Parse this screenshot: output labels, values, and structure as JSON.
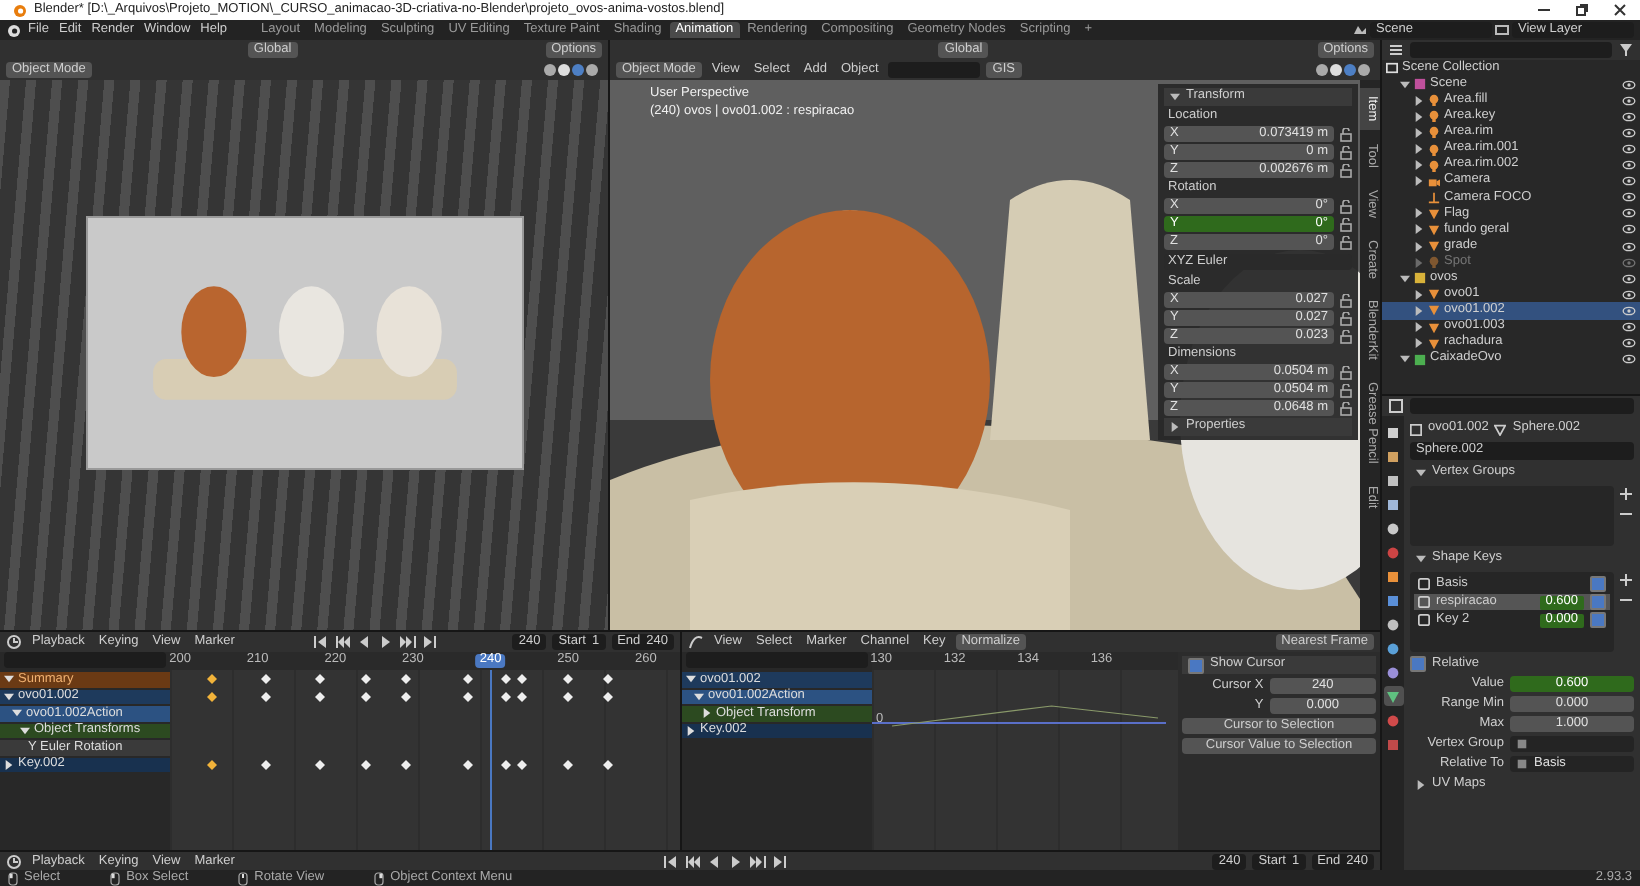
{
  "title_bar": {
    "title": "Blender* [D:\\_Arquivos\\Projeto_MOTION\\_CURSO_animacao-3D-criativa-no-Blender\\projeto_ovos-anima-vostos.blend]"
  },
  "menu_bar": {
    "menus": [
      "File",
      "Edit",
      "Render",
      "Window",
      "Help"
    ],
    "workspaces": [
      {
        "label": "Layout",
        "selected": false
      },
      {
        "label": "Modeling",
        "selected": false
      },
      {
        "label": "Sculpting",
        "selected": false
      },
      {
        "label": "UV Editing",
        "selected": false
      },
      {
        "label": "Texture Paint",
        "selected": false
      },
      {
        "label": "Shading",
        "selected": false
      },
      {
        "label": "Animation",
        "selected": true
      },
      {
        "label": "Rendering",
        "selected": false
      },
      {
        "label": "Compositing",
        "selected": false
      },
      {
        "label": "Geometry Nodes",
        "selected": false
      },
      {
        "label": "Scripting",
        "selected": false
      }
    ],
    "add_workspace": "+",
    "scene": "Scene",
    "view_layer": "View Layer"
  },
  "camera_view": {
    "orientation": "Global",
    "options": "Options",
    "mode": "Object Mode"
  },
  "viewport": {
    "orientation": "Global",
    "options": "Options",
    "mode": "Object Mode",
    "menus": [
      "View",
      "Select",
      "Add",
      "Object"
    ],
    "gis": "GIS",
    "view_name": "User Perspective",
    "view_info": "(240) ovos | ovo01.002 : respiracao"
  },
  "n_panel": {
    "tabs": [
      {
        "label": "Item",
        "selected": true
      },
      {
        "label": "Tool",
        "selected": false
      },
      {
        "label": "View",
        "selected": false
      },
      {
        "label": "Create",
        "selected": false
      },
      {
        "label": "BlenderKit",
        "selected": false
      },
      {
        "label": "Grease Pencil",
        "selected": false
      },
      {
        "label": "Edit",
        "selected": false
      }
    ],
    "transform": {
      "title": "Transform",
      "expanded": true,
      "groups": [
        {
          "label": "Location",
          "fields": [
            {
              "axis": "X",
              "value": "0.073419 m",
              "keyed": false
            },
            {
              "axis": "Y",
              "value": "0 m",
              "keyed": false
            },
            {
              "axis": "Z",
              "value": "0.002676 m",
              "keyed": false
            }
          ]
        },
        {
          "label": "Rotation",
          "fields": [
            {
              "axis": "X",
              "value": "0°",
              "keyed": false
            },
            {
              "axis": "Y",
              "value": "0°",
              "keyed": true
            },
            {
              "axis": "Z",
              "value": "0°",
              "keyed": false
            }
          ],
          "mode": "XYZ Euler"
        },
        {
          "label": "Scale",
          "fields": [
            {
              "axis": "X",
              "value": "0.027",
              "keyed": false
            },
            {
              "axis": "Y",
              "value": "0.027",
              "keyed": false
            },
            {
              "axis": "Z",
              "value": "0.023",
              "keyed": false
            }
          ]
        },
        {
          "label": "Dimensions",
          "fields": [
            {
              "axis": "X",
              "value": "0.0504 m",
              "keyed": false
            },
            {
              "axis": "Y",
              "value": "0.0504 m",
              "keyed": false
            },
            {
              "axis": "Z",
              "value": "0.0648 m",
              "keyed": false
            }
          ]
        }
      ]
    },
    "properties": {
      "title": "Properties",
      "expanded": false
    }
  },
  "outliner": {
    "root": "Scene Collection",
    "items": [
      {
        "name": "Scene",
        "kind": "collection",
        "color": "#c0509c",
        "expanded": true,
        "selected": false,
        "disabled": false,
        "children": [
          {
            "name": "Area.fill",
            "kind": "light",
            "expanded": false,
            "selected": false,
            "disabled": false
          },
          {
            "name": "Area.key",
            "kind": "light",
            "expanded": false,
            "selected": false,
            "disabled": false
          },
          {
            "name": "Area.rim",
            "kind": "light",
            "expanded": false,
            "selected": false,
            "disabled": false
          },
          {
            "name": "Area.rim.001",
            "kind": "light",
            "expanded": false,
            "selected": false,
            "disabled": false
          },
          {
            "name": "Area.rim.002",
            "kind": "light",
            "expanded": false,
            "selected": false,
            "disabled": false
          },
          {
            "name": "Camera",
            "kind": "camera",
            "expanded": false,
            "selected": false,
            "disabled": false
          },
          {
            "name": "Camera FOCO",
            "kind": "empty",
            "selected": false,
            "disabled": false
          },
          {
            "name": "Flag",
            "kind": "mesh",
            "expanded": false,
            "selected": false,
            "disabled": false
          },
          {
            "name": "fundo geral",
            "kind": "mesh",
            "expanded": false,
            "selected": false,
            "disabled": false
          },
          {
            "name": "grade",
            "kind": "mesh",
            "expanded": false,
            "selected": false,
            "disabled": false
          },
          {
            "name": "Spot",
            "kind": "light",
            "expanded": false,
            "selected": false,
            "disabled": true
          }
        ]
      },
      {
        "name": "ovos",
        "kind": "collection",
        "color": "#d8b23a",
        "expanded": true,
        "selected": false,
        "disabled": false,
        "children": [
          {
            "name": "ovo01",
            "kind": "mesh",
            "expanded": false,
            "selected": false,
            "disabled": false
          },
          {
            "name": "ovo01.002",
            "kind": "mesh",
            "expanded": false,
            "selected": true,
            "disabled": false
          },
          {
            "name": "ovo01.003",
            "kind": "mesh",
            "expanded": false,
            "selected": false,
            "disabled": false
          },
          {
            "name": "rachadura",
            "kind": "mesh",
            "expanded": false,
            "selected": false,
            "disabled": false
          }
        ]
      },
      {
        "name": "CaixadeOvo",
        "kind": "collection",
        "color": "#4caf50",
        "expanded": true,
        "selected": false,
        "disabled": false
      }
    ]
  },
  "properties": {
    "tabs": [
      {
        "kind": "square",
        "selected": false
      },
      {
        "kind": "square",
        "selected": false
      },
      {
        "kind": "square",
        "selected": false
      },
      {
        "kind": "square",
        "selected": false
      },
      {
        "kind": "circle",
        "selected": false
      },
      {
        "kind": "circle",
        "selected": false
      },
      {
        "kind": "square",
        "selected": false
      },
      {
        "kind": "square",
        "selected": false
      },
      {
        "kind": "circle",
        "selected": false
      },
      {
        "kind": "circle",
        "selected": false
      },
      {
        "kind": "circle",
        "selected": false
      },
      {
        "kind": "triangle",
        "selected": true
      },
      {
        "kind": "circle",
        "selected": false
      },
      {
        "kind": "square",
        "selected": false
      }
    ],
    "breadcrumb": [
      "ovo01.002",
      "Sphere.002"
    ],
    "mesh": "Sphere.002",
    "vertex_groups": {
      "title": "Vertex Groups",
      "expanded": true
    },
    "shape_keys": {
      "title": "Shape Keys",
      "expanded": true,
      "keys": [
        {
          "name": "Basis",
          "selected": false,
          "checked": true
        },
        {
          "name": "respiracao",
          "value": "0.600",
          "keyed": true,
          "selected": true,
          "checked": true
        },
        {
          "name": "Key 2",
          "value": "0.000",
          "keyed": true,
          "selected": false,
          "checked": true
        }
      ],
      "relative": {
        "label": "Relative",
        "checked": true
      },
      "fields": [
        {
          "label": "Value",
          "value": "0.600",
          "kind": "slider",
          "keyed": true
        },
        {
          "label": "Range Min",
          "value": "0.000",
          "kind": "number",
          "keyed": false
        },
        {
          "label": "Max",
          "value": "1.000",
          "kind": "number",
          "keyed": false
        },
        {
          "label": "Vertex Group",
          "kind": "search"
        },
        {
          "label": "Relative To",
          "value": "Basis",
          "kind": "search"
        }
      ]
    },
    "uv_maps": {
      "title": "UV Maps",
      "expanded": false
    }
  },
  "dopesheet": {
    "header": {
      "menus": [
        "Playback",
        "Keying",
        "View",
        "Marker"
      ],
      "frame": "240",
      "start_label": "Start",
      "start": "1",
      "end_label": "End",
      "end": "240"
    },
    "ruler": [
      {
        "label": "200",
        "current": false
      },
      {
        "label": "210",
        "current": false
      },
      {
        "label": "220",
        "current": false
      },
      {
        "label": "230",
        "current": false
      },
      {
        "label": "240",
        "current": true
      },
      {
        "label": "250",
        "current": false
      },
      {
        "label": "260",
        "current": false
      }
    ],
    "channels": [
      {
        "name": "Summary",
        "kind": "summary",
        "expanded": true,
        "keyframes": [
          {
            "selected": true
          },
          {
            "selected": false
          },
          {
            "selected": false
          },
          {
            "selected": false
          },
          {
            "selected": false
          },
          {
            "selected": false
          },
          {
            "selected": false
          },
          {
            "selected": false
          },
          {
            "selected": false
          },
          {
            "selected": false
          }
        ]
      },
      {
        "name": "ovo01.002",
        "kind": "object",
        "expanded": true,
        "keyframes": [
          {
            "selected": true
          },
          {
            "selected": false
          },
          {
            "selected": false
          },
          {
            "selected": false
          },
          {
            "selected": false
          },
          {
            "selected": false
          },
          {
            "selected": false
          },
          {
            "selected": false
          },
          {
            "selected": false
          },
          {
            "selected": false
          }
        ],
        "children": [
          {
            "name": "ovo01.002Action",
            "kind": "action",
            "expanded": true,
            "children": [
              {
                "name": "Object Transforms",
                "kind": "group",
                "expanded": true,
                "children": [
                  {
                    "name": "Y Euler Rotation",
                    "kind": "fcurve"
                  }
                ]
              }
            ]
          }
        ]
      },
      {
        "name": "Key.002",
        "kind": "shapekey",
        "expanded": false,
        "keyframes": [
          {
            "selected": true
          },
          {
            "selected": false
          },
          {
            "selected": false
          },
          {
            "selected": false
          },
          {
            "selected": false
          },
          {
            "selected": false
          },
          {
            "selected": false
          },
          {
            "selected": false
          },
          {
            "selected": false
          },
          {
            "selected": false
          }
        ]
      }
    ]
  },
  "graph": {
    "menus": [
      "View",
      "Select",
      "Marker",
      "Channel",
      "Key"
    ],
    "normalize": "Normalize",
    "snap": "Nearest Frame",
    "ruler": [
      "130",
      "132",
      "134",
      "136"
    ],
    "value_labels": [
      "0"
    ],
    "channels": [
      {
        "name": "ovo01.002",
        "kind": "object",
        "expanded": true,
        "children": [
          {
            "name": "ovo01.002Action",
            "kind": "action",
            "expanded": true,
            "children": [
              {
                "name": "Object Transform",
                "kind": "group",
                "expanded": false
              }
            ]
          }
        ]
      },
      {
        "name": "Key.002",
        "kind": "shapekey",
        "expanded": false
      }
    ],
    "cursor": {
      "title": "Show Cursor",
      "checked": true,
      "fields": [
        {
          "label": "Cursor X",
          "value": "240"
        },
        {
          "label": "Y",
          "value": "0.000"
        }
      ],
      "buttons": [
        "Cursor to Selection",
        "Cursor Value to Selection"
      ]
    }
  },
  "timeline": {
    "menus": [
      "Playback",
      "Keying",
      "View",
      "Marker"
    ],
    "frame": "240",
    "start_label": "Start",
    "start": "1",
    "end_label": "End",
    "end": "240"
  },
  "status_bar": {
    "items": [
      {
        "kind": "lmb",
        "label": "Select"
      },
      {
        "kind": "drag",
        "label": "Box Select"
      },
      {
        "kind": "mmb",
        "label": "Rotate View"
      },
      {
        "kind": "rmb",
        "label": "Object Context Menu"
      }
    ],
    "version": "2.93.3"
  }
}
